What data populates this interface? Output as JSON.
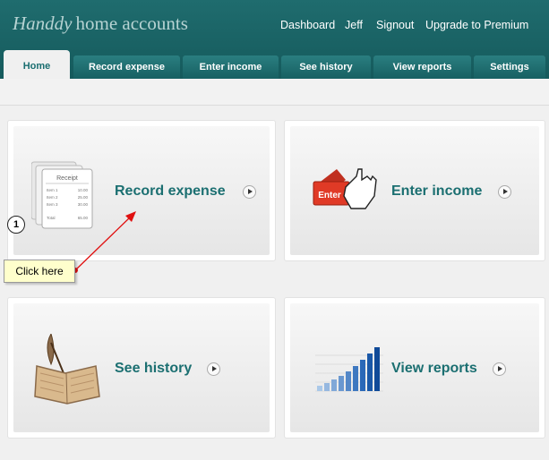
{
  "logo": {
    "script": "Handdy",
    "rest": "home accounts"
  },
  "topnav": [
    "Dashboard",
    "Jeff",
    "Signout",
    "Upgrade to Premium"
  ],
  "tabs": [
    "Home",
    "Record expense",
    "Enter income",
    "See history",
    "View reports",
    "Settings"
  ],
  "cards": [
    {
      "label": "Record expense",
      "icon": "receipt-icon"
    },
    {
      "label": "Enter income",
      "icon": "enter-key-icon"
    },
    {
      "label": "See history",
      "icon": "book-quill-icon"
    },
    {
      "label": "View reports",
      "icon": "bar-chart-icon"
    }
  ],
  "receipt": {
    "title": "Receipt",
    "rows": [
      [
        "Item 1",
        "10.00"
      ],
      [
        "Item 2",
        "25.00"
      ],
      [
        "Item 3",
        "30.00"
      ]
    ],
    "total": [
      "Total",
      "65.00"
    ]
  },
  "enter_key": "Enter",
  "annotation": {
    "number": "1",
    "tooltip": "Click here"
  },
  "colors": {
    "header": "#1f6c6e",
    "accent": "#1b6f71",
    "annotation_arrow": "#e01010"
  }
}
